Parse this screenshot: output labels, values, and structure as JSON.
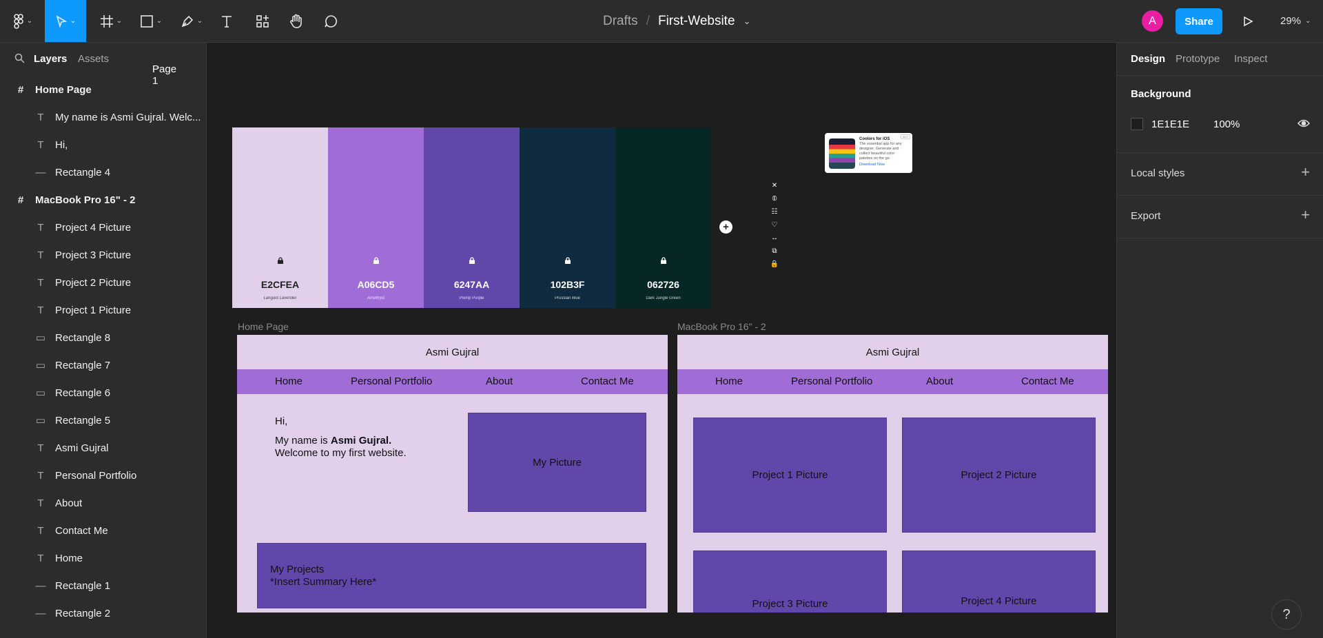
{
  "topbar": {
    "file": {
      "folder": "Drafts",
      "name": "First-Website"
    },
    "avatar_letter": "A",
    "share_label": "Share",
    "zoom": "29%"
  },
  "leftpanel": {
    "tabs": {
      "layers": "Layers",
      "assets": "Assets"
    },
    "page": "Page 1",
    "layers": [
      {
        "name": "Home Page",
        "type": "frame"
      },
      {
        "name": "My name is Asmi Gujral. Welc...",
        "type": "text"
      },
      {
        "name": "Hi,",
        "type": "text"
      },
      {
        "name": "Rectangle 4",
        "type": "line"
      },
      {
        "name": "MacBook Pro 16\" - 2",
        "type": "frame"
      },
      {
        "name": "Project 4 Picture",
        "type": "text"
      },
      {
        "name": "Project 3 Picture",
        "type": "text"
      },
      {
        "name": "Project 2 Picture",
        "type": "text"
      },
      {
        "name": "Project 1 Picture",
        "type": "text"
      },
      {
        "name": "Rectangle 8",
        "type": "rect"
      },
      {
        "name": "Rectangle 7",
        "type": "rect"
      },
      {
        "name": "Rectangle 6",
        "type": "rect"
      },
      {
        "name": "Rectangle 5",
        "type": "rect"
      },
      {
        "name": "Asmi Gujral",
        "type": "text"
      },
      {
        "name": "Personal Portfolio",
        "type": "text"
      },
      {
        "name": "About",
        "type": "text"
      },
      {
        "name": "Contact Me",
        "type": "text"
      },
      {
        "name": "Home",
        "type": "text"
      },
      {
        "name": "Rectangle 1",
        "type": "line"
      },
      {
        "name": "Rectangle 2",
        "type": "line"
      }
    ]
  },
  "rightpanel": {
    "tabs": {
      "design": "Design",
      "prototype": "Prototype",
      "inspect": "Inspect"
    },
    "background": {
      "title": "Background",
      "hex": "1E1E1E",
      "opacity": "100%"
    },
    "local_styles": "Local styles",
    "export": "Export"
  },
  "palette": [
    {
      "hex": "E2CFEA",
      "name": "Languid Lavender",
      "color": "#e2cfea",
      "text_color": "#222222"
    },
    {
      "hex": "A06CD5",
      "name": "Amethyst",
      "color": "#a06cd5",
      "text_color": "#ffffff"
    },
    {
      "hex": "6247AA",
      "name": "Plump Purple",
      "color": "#6247aa",
      "text_color": "#ffffff"
    },
    {
      "hex": "102B3F",
      "name": "Prussian Blue",
      "color": "#102b3f",
      "text_color": "#ffffff"
    },
    {
      "hex": "062726",
      "name": "Dark Jungle Green",
      "color": "#062726",
      "text_color": "#ffffff"
    }
  ],
  "palette_tools": [
    "✕",
    "⦶",
    "☷",
    "♡",
    "↔",
    "⧉",
    "🔒"
  ],
  "ad": {
    "title": "Coolors for iOS",
    "text": "The essential app for any designer. Generate and collect beautiful color palettes on the go.",
    "link": "Download Now",
    "badge": "ADS"
  },
  "home_page": {
    "label": "Home Page",
    "title": "Asmi Gujral",
    "nav": [
      "Home",
      "Personal Portfolio",
      "About",
      "Contact Me"
    ],
    "greeting": "Hi,",
    "intro_prefix": "My name is ",
    "intro_name": "Asmi Gujral.",
    "intro_line2": "Welcome to my first website.",
    "picture": "My Picture",
    "projects_title": "My Projects",
    "projects_summary": "*Insert Summary Here*"
  },
  "macbook": {
    "label": "MacBook Pro 16\" - 2",
    "title": "Asmi Gujral",
    "nav": [
      "Home",
      "Personal Portfolio",
      "About",
      "Contact Me"
    ],
    "projects": [
      "Project 1 Picture",
      "Project 2 Picture",
      "Project 3 Picture",
      "Project 4 Picture"
    ]
  },
  "colors": {
    "accent": "#0d99ff",
    "lavender": "#e2cfea",
    "amethyst": "#a06cd5",
    "plump_purple": "#6247aa"
  }
}
